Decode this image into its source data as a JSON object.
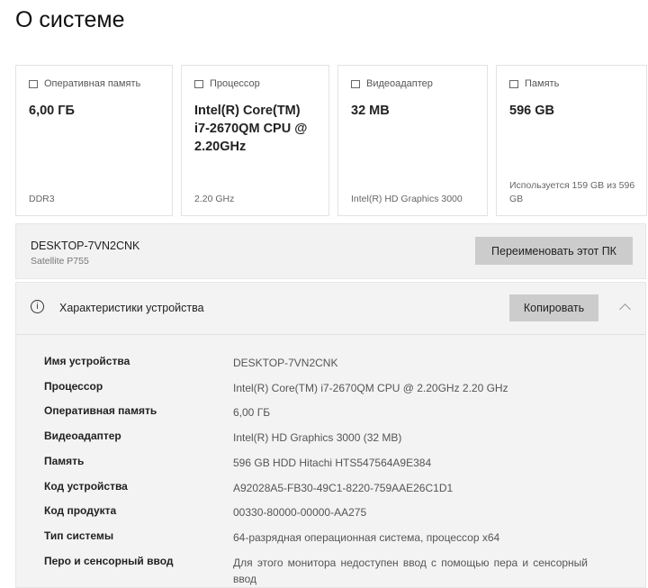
{
  "title": "О системе",
  "cards": [
    {
      "icon": "memory-icon",
      "label": "Оперативная память",
      "value": "6,00 ГБ",
      "sub": "DDR3"
    },
    {
      "icon": "processor-icon",
      "label": "Процессор",
      "value": "Intel(R) Core(TM) i7-2670QM CPU @ 2.20GHz",
      "sub": "2.20 GHz"
    },
    {
      "icon": "display-adapter-icon",
      "label": "Видеоадаптер",
      "value": "32 MB",
      "sub": "Intel(R) HD Graphics 3000"
    },
    {
      "icon": "storage-icon",
      "label": "Память",
      "value": "596 GB",
      "sub": "Используется 159 GB из 596 GB"
    }
  ],
  "device": {
    "name": "DESKTOP-7VN2CNK",
    "model": "Satellite P755",
    "rename_label": "Переименовать этот ПК"
  },
  "specs": {
    "title": "Характеристики устройства",
    "copy_label": "Копировать",
    "rows": [
      {
        "k": "Имя устройства",
        "v": "DESKTOP-7VN2CNK"
      },
      {
        "k": "Процессор",
        "v": "Intel(R) Core(TM) i7-2670QM CPU @ 2.20GHz   2.20 GHz"
      },
      {
        "k": "Оперативная память",
        "v": "6,00 ГБ"
      },
      {
        "k": "Видеоадаптер",
        "v": "Intel(R) HD Graphics 3000 (32 MB)"
      },
      {
        "k": "Память",
        "v": "596 GB HDD Hitachi HTS547564A9E384"
      },
      {
        "k": "Код устройства",
        "v": "A92028A5-FB30-49C1-8220-759AAE26C1D1"
      },
      {
        "k": "Код продукта",
        "v": "00330-80000-00000-AA275"
      },
      {
        "k": "Тип системы",
        "v": "64-разрядная операционная система, процессор x64"
      },
      {
        "k": "Перо и сенсорный ввод",
        "v": "Для этого монитора недоступен ввод с помощью пера и сенсорный ввод"
      }
    ]
  }
}
